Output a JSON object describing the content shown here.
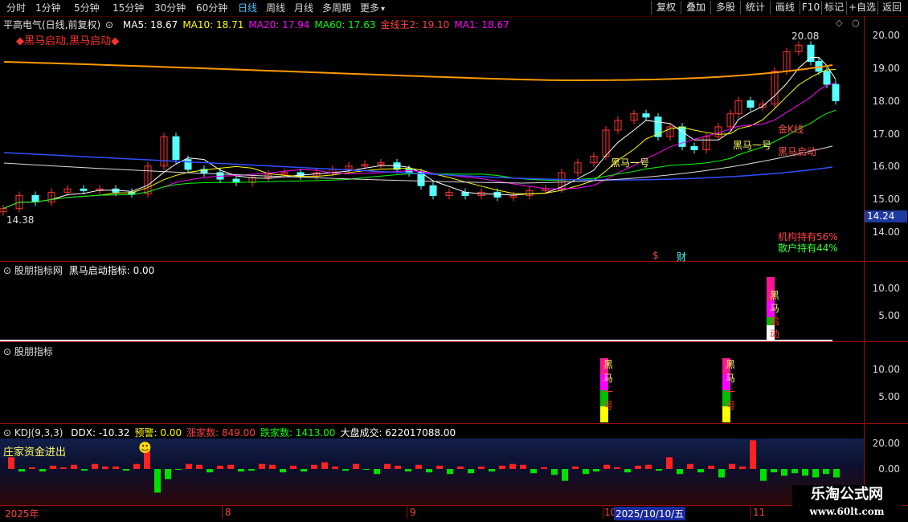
{
  "toolbar": {
    "periods": [
      "分时",
      "1分钟",
      "5分钟",
      "15分钟",
      "30分钟",
      "60分钟",
      "日线",
      "周线",
      "月线",
      "多周期",
      "更多"
    ],
    "active_period": "日线",
    "more_arrow": "▾",
    "buttons": [
      "复权",
      "叠加",
      "多股",
      "统计",
      "画线",
      "F10",
      "标记",
      "+自选",
      "返回"
    ]
  },
  "main_pane": {
    "stock_name": "平高电气(日线,前复权)",
    "ma_items": [
      {
        "label": "MA5: 18.67",
        "color": "#ffffff"
      },
      {
        "label": "MA10: 18.71",
        "color": "#ffff00"
      },
      {
        "label": "MA20: 17.94",
        "color": "#ff00ff"
      },
      {
        "label": "MA60: 17.63",
        "color": "#00ff00"
      },
      {
        "label": "金线王2: 19.10",
        "color": "#ff4040"
      },
      {
        "label": "MA1: 18.67",
        "color": "#ff00ff"
      }
    ],
    "signal_banner": "◆黑马启动,黑马启动◆",
    "high_label": "20.08",
    "low_label": "14.38",
    "current_price": "14.24",
    "holdings": {
      "institution": "机构持有56%",
      "retail": "散户持有44%"
    },
    "markers": {
      "dollar": "$",
      "finance": "财"
    },
    "annotations": [
      {
        "text": "黑马一号",
        "color": "#ffff66"
      },
      {
        "text": "黑马一号",
        "color": "#ffff66"
      },
      {
        "text": "金K线",
        "color": "#ff5050"
      },
      {
        "text": "黑马启动",
        "color": "#ff5050"
      }
    ],
    "y_axis": [
      "20.00",
      "19.00",
      "18.00",
      "17.00",
      "16.00",
      "15.00",
      "14.00"
    ]
  },
  "pane2": {
    "title": "股朋指标网",
    "indicator": "黑马启动指标: 0.00",
    "y_axis": [
      "10.00",
      "5.00"
    ],
    "bar_text": [
      "黑",
      "马",
      "启",
      "动"
    ]
  },
  "pane3": {
    "title": "股朋指标",
    "y_axis": [
      "10.00",
      "5.00"
    ],
    "bar_text": [
      "黑",
      "马",
      "一",
      "号"
    ]
  },
  "pane4": {
    "title": "KDJ(9,3,3)",
    "items": [
      {
        "label": "DDX: -10.32",
        "color": "#ffffff"
      },
      {
        "label": "预警: 0.00",
        "color": "#ffff00"
      },
      {
        "label": "涨家数: 849.00",
        "color": "#ff4040"
      },
      {
        "label": "跌家数: 1413.00",
        "color": "#00ff00"
      },
      {
        "label": "大盘成交: 622017088.00",
        "color": "#ffffff"
      }
    ],
    "left_label": "庄家资金进出",
    "emoji": "☻",
    "y_axis": [
      "20.00",
      "0.00"
    ]
  },
  "date_axis": {
    "labels": [
      "2025年",
      "8",
      "9",
      "10",
      "11"
    ],
    "cursor_date": "2025/10/10/五"
  },
  "watermark": {
    "title": "乐淘公式网",
    "url": "www.60lt.com"
  },
  "colors": {
    "up": "#ff3333",
    "down": "#54ffff",
    "grid": "#9a1010",
    "active": "#4fc3ff"
  }
}
